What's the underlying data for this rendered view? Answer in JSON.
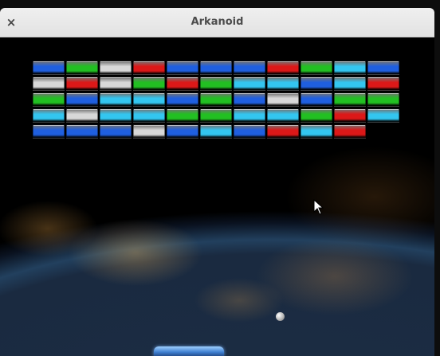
{
  "window": {
    "title": "Arkanoid",
    "close_symbol": "×"
  },
  "colors": {
    "blue": "#1f5fe0",
    "green": "#22c022",
    "white": "#d8d8d8",
    "red": "#dc1818",
    "cyan": "#33c6f0"
  },
  "bricks": [
    [
      "blue",
      "green",
      "white",
      "red",
      "blue",
      "blue",
      "blue",
      "red",
      "green",
      "cyan",
      "blue"
    ],
    [
      "white",
      "red",
      "white",
      "green",
      "red",
      "green",
      "cyan",
      "cyan",
      "blue",
      "cyan",
      "red"
    ],
    [
      "green",
      "blue",
      "cyan",
      "cyan",
      "blue",
      "green",
      "blue",
      "white",
      "blue",
      "green",
      "green"
    ],
    [
      "cyan",
      "white",
      "cyan",
      "cyan",
      "green",
      "green",
      "cyan",
      "cyan",
      "green",
      "red",
      "cyan"
    ],
    [
      "blue",
      "blue",
      "blue",
      "white",
      "blue",
      "cyan",
      "blue",
      "red",
      "cyan",
      "red",
      null
    ]
  ]
}
